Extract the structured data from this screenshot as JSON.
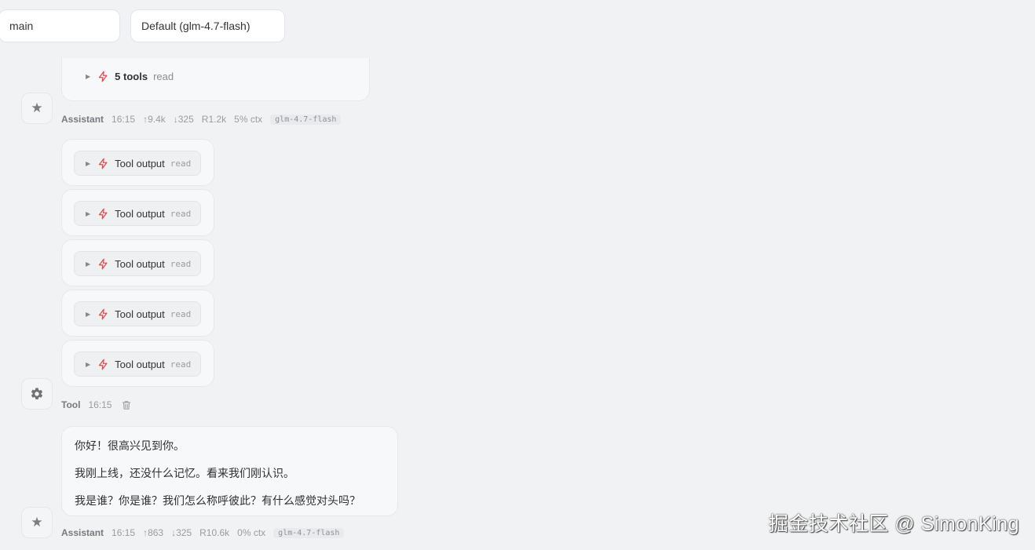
{
  "header": {
    "branch_select": "main",
    "model_select": "Default (glm-4.7-flash)"
  },
  "messages": [
    {
      "tools_summary": {
        "count_label": "5 tools",
        "kind": "read"
      },
      "meta": {
        "role": "Assistant",
        "time": "16:15",
        "tokens_in": "↑9.4k",
        "tokens_out": "↓325",
        "reasoning": "R1.2k",
        "ctx": "5% ctx",
        "model": "glm-4.7-flash"
      }
    },
    {
      "tool_outputs": [
        {
          "label": "Tool output",
          "kind": "read"
        },
        {
          "label": "Tool output",
          "kind": "read"
        },
        {
          "label": "Tool output",
          "kind": "read"
        },
        {
          "label": "Tool output",
          "kind": "read"
        },
        {
          "label": "Tool output",
          "kind": "read"
        }
      ],
      "meta": {
        "role": "Tool",
        "time": "16:15"
      }
    },
    {
      "paragraphs": [
        "你好！很高兴见到你。",
        "我刚上线，还没什么记忆。看来我们刚认识。",
        "我是谁？你是谁？我们怎么称呼彼此？有什么感觉对头吗？"
      ],
      "meta": {
        "role": "Assistant",
        "time": "16:15",
        "tokens_in": "↑863",
        "tokens_out": "↓325",
        "reasoning": "R10.6k",
        "ctx": "0% ctx",
        "model": "glm-4.7-flash"
      }
    }
  ],
  "watermark": "掘金技术社区 @ SimonKing",
  "icons": {
    "assistant_avatar": "star-icon",
    "tool_avatar": "gear-icon",
    "tool": "lightning-icon",
    "delete": "trash-icon"
  },
  "colors": {
    "accent": "#e5484d",
    "background": "#f1f2f4",
    "card": "#f7f8fa"
  }
}
